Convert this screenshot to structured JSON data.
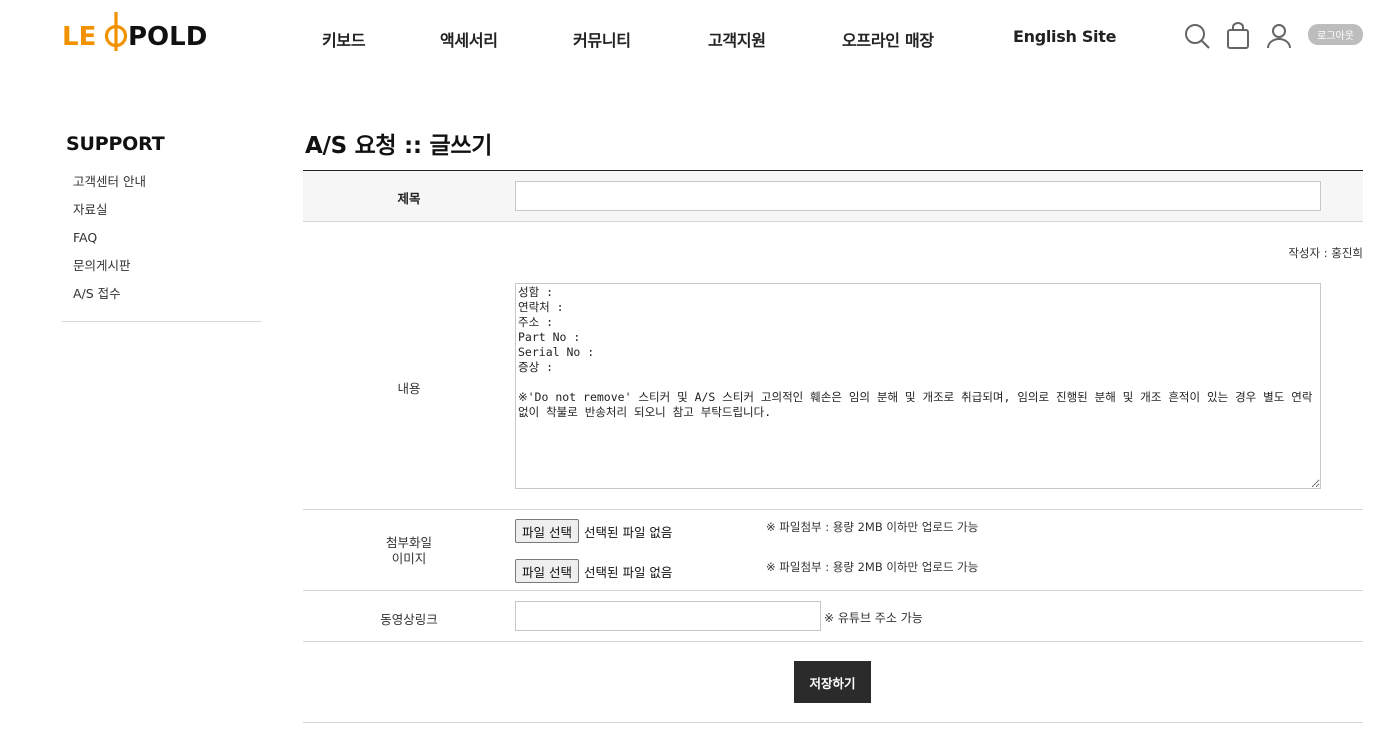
{
  "brand": {
    "logo_text": "LEOPOLD",
    "accent": "#f39200"
  },
  "nav": [
    {
      "label": "키보드"
    },
    {
      "label": "액세서리"
    },
    {
      "label": "커뮤니티"
    },
    {
      "label": "고객지원"
    },
    {
      "label": "오프라인 매장"
    },
    {
      "label": "English Site"
    }
  ],
  "utility": {
    "icons": [
      "search-icon",
      "cart-icon",
      "user-icon"
    ],
    "logout_label": "로그아웃"
  },
  "sidebar": {
    "title": "SUPPORT",
    "items": [
      {
        "label": "고객센터 안내"
      },
      {
        "label": "자료실"
      },
      {
        "label": "FAQ"
      },
      {
        "label": "문의게시판"
      },
      {
        "label": "A/S 접수"
      }
    ]
  },
  "page": {
    "title": "A/S 요청 :: 글쓰기"
  },
  "form": {
    "subject": {
      "label": "제목",
      "value": ""
    },
    "writer": "작성자 : 홍진희",
    "content": {
      "label": "내용",
      "value": "성함 :\n연락처 :\n주소 :\nPart No :\nSerial No :\n증상 :\n\n※'Do not remove' 스티커 및 A/S 스티커 고의적인 훼손은 임의 분해 및 개조로 취급되며, 임의로 진행된 분해 및 개조 흔적이 있는 경우 별도 연락없이 착불로 반송처리 되오니 참고 부탁드립니다."
    },
    "attachment": {
      "label_line1": "첨부화일",
      "label_line2": "이미지",
      "files": [
        {
          "button": "파일 선택",
          "status": "선택된 파일 없음",
          "note": "※ 파일첨부 : 용량 2MB 이하만 업로드 가능"
        },
        {
          "button": "파일 선택",
          "status": "선택된 파일 없음",
          "note": "※ 파일첨부 : 용량 2MB 이하만 업로드 가능"
        }
      ]
    },
    "video": {
      "label": "동영상링크",
      "value": "",
      "note": "※ 유튜브 주소 가능"
    },
    "save_label": "저장하기"
  }
}
